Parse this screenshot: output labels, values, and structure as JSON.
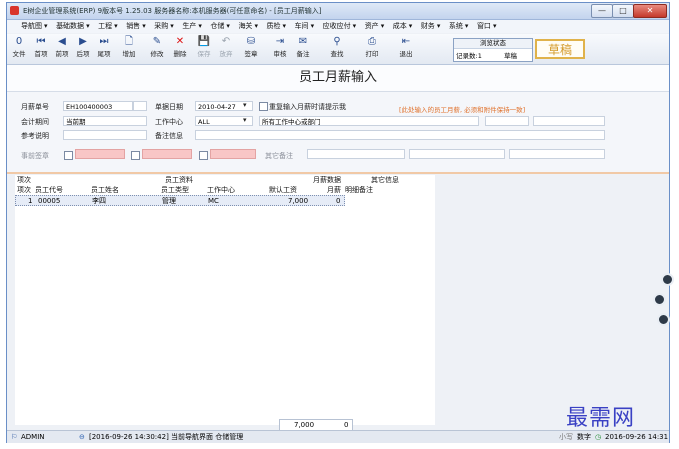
{
  "window": {
    "title": "E树企业管理系统(ERP) 9版本号 1.25.03  服务器名称:本机服务器(可任意命名) - [员工月薪输入]",
    "buttons": {
      "min": "—",
      "max": "□",
      "close": "✕"
    }
  },
  "menu": [
    "导航图",
    "基础数据",
    "工程",
    "销售",
    "采购",
    "生产",
    "仓储",
    "海关",
    "质检",
    "车间",
    "应收应付",
    "资产",
    "成本",
    "财务",
    "系统",
    "窗口"
  ],
  "toolbar": [
    {
      "icon": "file-icon",
      "glyph": "0",
      "label": "文件"
    },
    {
      "icon": "first-record-icon",
      "glyph": "⏮",
      "label": "首项"
    },
    {
      "icon": "prev-record-icon",
      "glyph": "◀",
      "label": "前项"
    },
    {
      "icon": "next-record-icon",
      "glyph": "▶",
      "label": "后项"
    },
    {
      "icon": "last-record-icon",
      "glyph": "⏭",
      "label": "尾项"
    },
    {
      "icon": "add-icon",
      "glyph": "🗋",
      "label": "增加"
    },
    {
      "icon": "edit-icon",
      "glyph": "✎",
      "label": "修改"
    },
    {
      "icon": "delete-icon",
      "glyph": "✕",
      "label": "删除"
    },
    {
      "icon": "save-icon",
      "glyph": "💾",
      "label": "保存"
    },
    {
      "icon": "undo-icon",
      "glyph": "↶",
      "label": "放弃"
    },
    {
      "icon": "approve-icon",
      "glyph": "⛁",
      "label": "签章"
    },
    {
      "icon": "review-icon",
      "glyph": "⇥",
      "label": "审核"
    },
    {
      "icon": "note-icon",
      "glyph": "✉",
      "label": "备注"
    },
    {
      "icon": "find-icon",
      "glyph": "⚲",
      "label": "查找"
    },
    {
      "icon": "print-icon",
      "glyph": "⎙",
      "label": "打印"
    },
    {
      "icon": "exit-icon",
      "glyph": "⇤",
      "label": "退出"
    }
  ],
  "browse_state": {
    "header": "浏览状态",
    "record_count": "记录数:1",
    "status": "草稿"
  },
  "draft_stamp": "草稿",
  "form_title": "员工月薪输入",
  "form": {
    "month_no_label": "月薪单号",
    "month_no": "EH100400003",
    "doc_date_label": "单据日期",
    "doc_date": "2010-04-27",
    "repeat_hint_label": "重复输入月薪时请提示我",
    "hint": "[此处输入的员工月薪, 必须和附件保持一致]",
    "period_label": "会计期间",
    "period": "当前期",
    "work_center_label": "工作中心",
    "work_center": "ALL",
    "work_center_desc": "所有工作中心或部门",
    "ref_label": "参考说明",
    "note_info_label": "备注信息",
    "approval_label": "事前签章",
    "other_note_label": "其它备注"
  },
  "grid": {
    "group_headers": [
      "项次",
      "员工资料",
      "月薪数据",
      "其它信息"
    ],
    "columns": [
      "项次",
      "员工代号",
      "员工姓名",
      "员工类型",
      "工作中心",
      "默认工资",
      "月薪",
      "明细备注"
    ],
    "rows": [
      {
        "no": "1",
        "code": "00005",
        "name": "李四",
        "type": "管理",
        "center": "MC",
        "default_wage": "7,000",
        "salary": "0",
        "remark": ""
      }
    ],
    "totals": {
      "default_wage": "7,000",
      "salary": "0"
    }
  },
  "status": {
    "user": "ADMIN",
    "message": "[2016-09-26 14:30:42] 当前导航界面 仓储管理",
    "mode": "小写",
    "numlock": "数字",
    "clock": "2016-09-26 14:31"
  },
  "watermark": "最需网"
}
